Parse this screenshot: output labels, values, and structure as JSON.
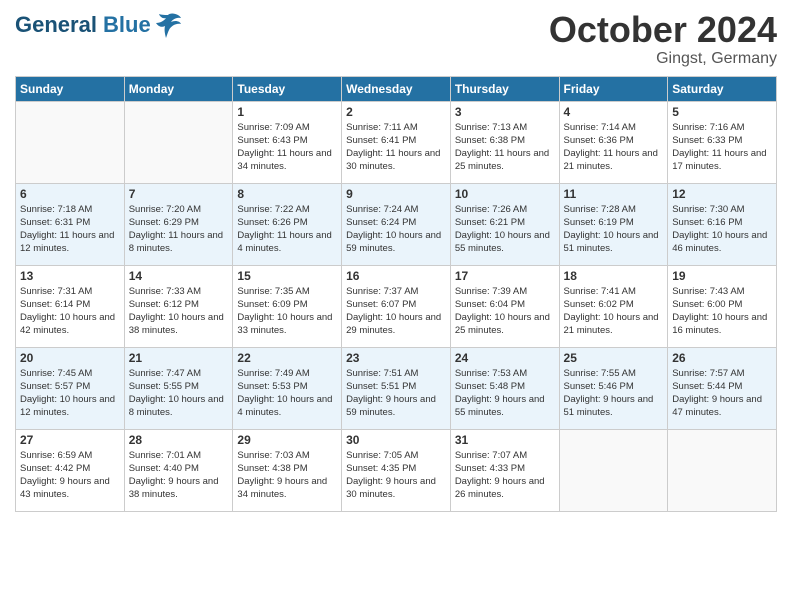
{
  "header": {
    "logo_general": "General",
    "logo_blue": "Blue",
    "month_title": "October 2024",
    "location": "Gingst, Germany"
  },
  "columns": [
    "Sunday",
    "Monday",
    "Tuesday",
    "Wednesday",
    "Thursday",
    "Friday",
    "Saturday"
  ],
  "weeks": [
    [
      {
        "day": "",
        "sunrise": "",
        "sunset": "",
        "daylight": ""
      },
      {
        "day": "",
        "sunrise": "",
        "sunset": "",
        "daylight": ""
      },
      {
        "day": "1",
        "sunrise": "Sunrise: 7:09 AM",
        "sunset": "Sunset: 6:43 PM",
        "daylight": "Daylight: 11 hours and 34 minutes."
      },
      {
        "day": "2",
        "sunrise": "Sunrise: 7:11 AM",
        "sunset": "Sunset: 6:41 PM",
        "daylight": "Daylight: 11 hours and 30 minutes."
      },
      {
        "day": "3",
        "sunrise": "Sunrise: 7:13 AM",
        "sunset": "Sunset: 6:38 PM",
        "daylight": "Daylight: 11 hours and 25 minutes."
      },
      {
        "day": "4",
        "sunrise": "Sunrise: 7:14 AM",
        "sunset": "Sunset: 6:36 PM",
        "daylight": "Daylight: 11 hours and 21 minutes."
      },
      {
        "day": "5",
        "sunrise": "Sunrise: 7:16 AM",
        "sunset": "Sunset: 6:33 PM",
        "daylight": "Daylight: 11 hours and 17 minutes."
      }
    ],
    [
      {
        "day": "6",
        "sunrise": "Sunrise: 7:18 AM",
        "sunset": "Sunset: 6:31 PM",
        "daylight": "Daylight: 11 hours and 12 minutes."
      },
      {
        "day": "7",
        "sunrise": "Sunrise: 7:20 AM",
        "sunset": "Sunset: 6:29 PM",
        "daylight": "Daylight: 11 hours and 8 minutes."
      },
      {
        "day": "8",
        "sunrise": "Sunrise: 7:22 AM",
        "sunset": "Sunset: 6:26 PM",
        "daylight": "Daylight: 11 hours and 4 minutes."
      },
      {
        "day": "9",
        "sunrise": "Sunrise: 7:24 AM",
        "sunset": "Sunset: 6:24 PM",
        "daylight": "Daylight: 10 hours and 59 minutes."
      },
      {
        "day": "10",
        "sunrise": "Sunrise: 7:26 AM",
        "sunset": "Sunset: 6:21 PM",
        "daylight": "Daylight: 10 hours and 55 minutes."
      },
      {
        "day": "11",
        "sunrise": "Sunrise: 7:28 AM",
        "sunset": "Sunset: 6:19 PM",
        "daylight": "Daylight: 10 hours and 51 minutes."
      },
      {
        "day": "12",
        "sunrise": "Sunrise: 7:30 AM",
        "sunset": "Sunset: 6:16 PM",
        "daylight": "Daylight: 10 hours and 46 minutes."
      }
    ],
    [
      {
        "day": "13",
        "sunrise": "Sunrise: 7:31 AM",
        "sunset": "Sunset: 6:14 PM",
        "daylight": "Daylight: 10 hours and 42 minutes."
      },
      {
        "day": "14",
        "sunrise": "Sunrise: 7:33 AM",
        "sunset": "Sunset: 6:12 PM",
        "daylight": "Daylight: 10 hours and 38 minutes."
      },
      {
        "day": "15",
        "sunrise": "Sunrise: 7:35 AM",
        "sunset": "Sunset: 6:09 PM",
        "daylight": "Daylight: 10 hours and 33 minutes."
      },
      {
        "day": "16",
        "sunrise": "Sunrise: 7:37 AM",
        "sunset": "Sunset: 6:07 PM",
        "daylight": "Daylight: 10 hours and 29 minutes."
      },
      {
        "day": "17",
        "sunrise": "Sunrise: 7:39 AM",
        "sunset": "Sunset: 6:04 PM",
        "daylight": "Daylight: 10 hours and 25 minutes."
      },
      {
        "day": "18",
        "sunrise": "Sunrise: 7:41 AM",
        "sunset": "Sunset: 6:02 PM",
        "daylight": "Daylight: 10 hours and 21 minutes."
      },
      {
        "day": "19",
        "sunrise": "Sunrise: 7:43 AM",
        "sunset": "Sunset: 6:00 PM",
        "daylight": "Daylight: 10 hours and 16 minutes."
      }
    ],
    [
      {
        "day": "20",
        "sunrise": "Sunrise: 7:45 AM",
        "sunset": "Sunset: 5:57 PM",
        "daylight": "Daylight: 10 hours and 12 minutes."
      },
      {
        "day": "21",
        "sunrise": "Sunrise: 7:47 AM",
        "sunset": "Sunset: 5:55 PM",
        "daylight": "Daylight: 10 hours and 8 minutes."
      },
      {
        "day": "22",
        "sunrise": "Sunrise: 7:49 AM",
        "sunset": "Sunset: 5:53 PM",
        "daylight": "Daylight: 10 hours and 4 minutes."
      },
      {
        "day": "23",
        "sunrise": "Sunrise: 7:51 AM",
        "sunset": "Sunset: 5:51 PM",
        "daylight": "Daylight: 9 hours and 59 minutes."
      },
      {
        "day": "24",
        "sunrise": "Sunrise: 7:53 AM",
        "sunset": "Sunset: 5:48 PM",
        "daylight": "Daylight: 9 hours and 55 minutes."
      },
      {
        "day": "25",
        "sunrise": "Sunrise: 7:55 AM",
        "sunset": "Sunset: 5:46 PM",
        "daylight": "Daylight: 9 hours and 51 minutes."
      },
      {
        "day": "26",
        "sunrise": "Sunrise: 7:57 AM",
        "sunset": "Sunset: 5:44 PM",
        "daylight": "Daylight: 9 hours and 47 minutes."
      }
    ],
    [
      {
        "day": "27",
        "sunrise": "Sunrise: 6:59 AM",
        "sunset": "Sunset: 4:42 PM",
        "daylight": "Daylight: 9 hours and 43 minutes."
      },
      {
        "day": "28",
        "sunrise": "Sunrise: 7:01 AM",
        "sunset": "Sunset: 4:40 PM",
        "daylight": "Daylight: 9 hours and 38 minutes."
      },
      {
        "day": "29",
        "sunrise": "Sunrise: 7:03 AM",
        "sunset": "Sunset: 4:38 PM",
        "daylight": "Daylight: 9 hours and 34 minutes."
      },
      {
        "day": "30",
        "sunrise": "Sunrise: 7:05 AM",
        "sunset": "Sunset: 4:35 PM",
        "daylight": "Daylight: 9 hours and 30 minutes."
      },
      {
        "day": "31",
        "sunrise": "Sunrise: 7:07 AM",
        "sunset": "Sunset: 4:33 PM",
        "daylight": "Daylight: 9 hours and 26 minutes."
      },
      {
        "day": "",
        "sunrise": "",
        "sunset": "",
        "daylight": ""
      },
      {
        "day": "",
        "sunrise": "",
        "sunset": "",
        "daylight": ""
      }
    ]
  ]
}
